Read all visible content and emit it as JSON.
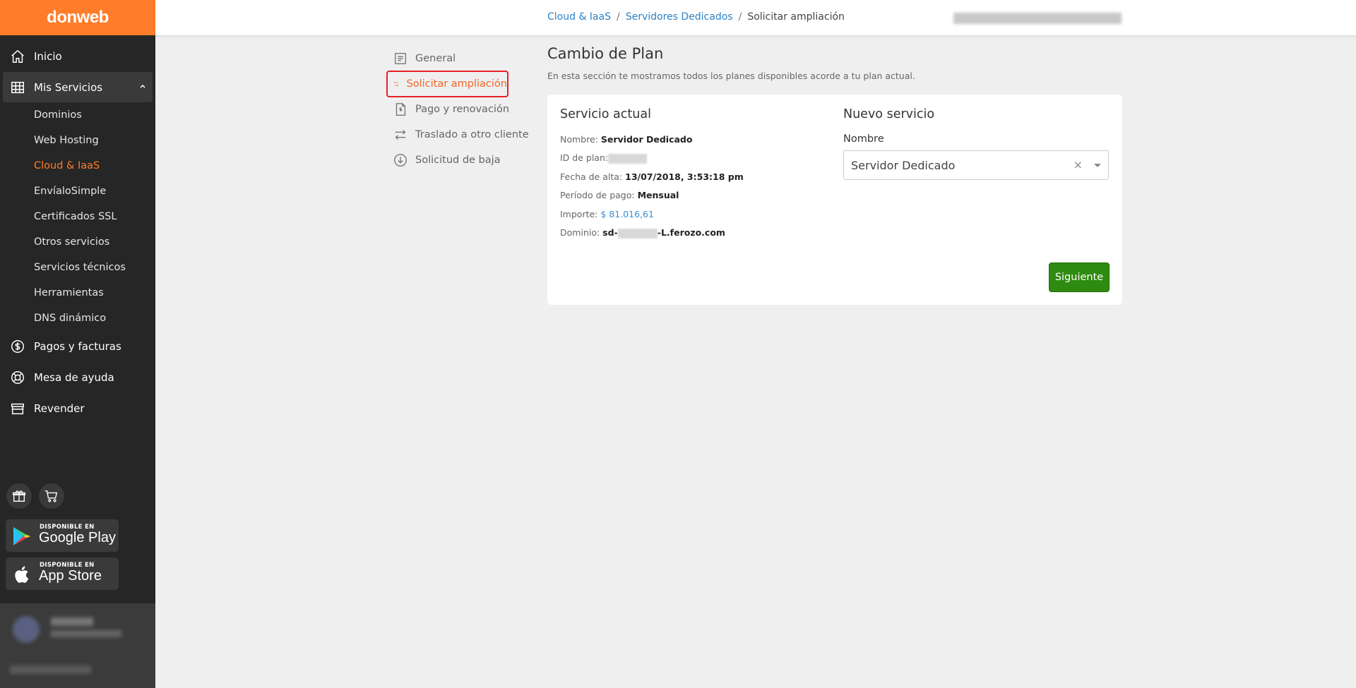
{
  "brand": {
    "logo_text": "donweb",
    "accent": "#ff7d2a"
  },
  "sidebar": {
    "items": [
      {
        "label": "Inicio",
        "icon": "home-icon"
      },
      {
        "label": "Mis Servicios",
        "icon": "grid-icon",
        "expanded": true
      },
      {
        "label": "Pagos y facturas",
        "icon": "dollar-circle-icon"
      },
      {
        "label": "Mesa de ayuda",
        "icon": "lifebuoy-icon"
      },
      {
        "label": "Revender",
        "icon": "store-icon"
      }
    ],
    "sub_items": [
      "Dominios",
      "Web Hosting",
      "Cloud & IaaS",
      "EnvíaloSimple",
      "Certificados SSL",
      "Otros servicios",
      "Servicios técnicos",
      "Herramientas",
      "DNS dinámico"
    ],
    "current_sub_item": "Cloud & IaaS",
    "google_play": {
      "small": "DISPONIBLE EN",
      "big": "Google Play"
    },
    "app_store": {
      "small": "DISPONIBLE EN",
      "big": "App Store"
    }
  },
  "breadcrumb": {
    "items": [
      "Cloud & IaaS",
      "Servidores Dedicados"
    ],
    "current": "Solicitar ampliación",
    "separator": "/"
  },
  "submenu": {
    "items": [
      "General",
      "Solicitar ampliación",
      "Pago y renovación",
      "Traslado a otro cliente",
      "Solicitud de baja"
    ],
    "selected": "Solicitar ampliación"
  },
  "main": {
    "title": "Cambio de Plan",
    "description": "En esta sección te mostramos todos los planes disponibles acorde a tu plan actual.",
    "current_service": {
      "title": "Servicio actual",
      "rows": [
        {
          "label": "Nombre:",
          "value": "Servidor Dedicado"
        },
        {
          "label": "ID de plan:",
          "value": ""
        },
        {
          "label": "Fecha de alta:",
          "value": "13/07/2018, 3:53:18 pm"
        },
        {
          "label": "Período de pago:",
          "value": "Mensual"
        },
        {
          "label": "Importe:",
          "value": "$ 81.016,61"
        },
        {
          "label": "Dominio:",
          "value_prefix": "sd-",
          "value_suffix": "-L.ferozo.com"
        }
      ]
    },
    "new_service": {
      "title": "Nuevo servicio",
      "field_label": "Nombre",
      "selected_value": "Servidor Dedicado",
      "clear_symbol": "×"
    },
    "next_button": "Siguiente"
  },
  "colors": {
    "link": "#2b82c7",
    "button_green": "#2e8b0f",
    "highlight_red": "#e5202a",
    "selected_orange": "#f26522"
  }
}
